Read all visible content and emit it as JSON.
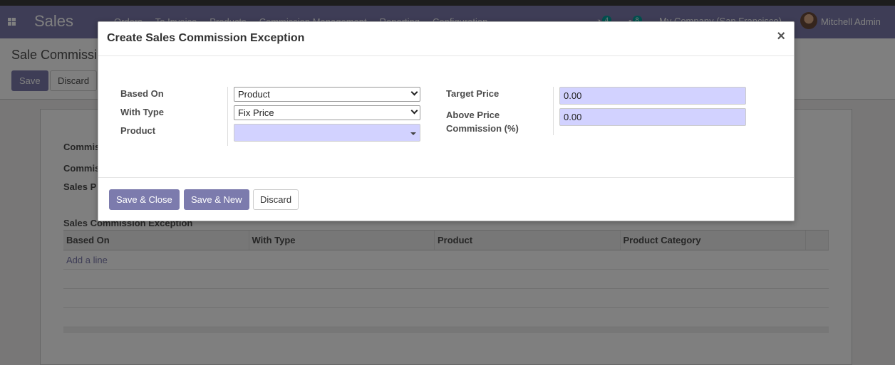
{
  "navbar": {
    "app_name": "Sales",
    "menu": [
      "Orders",
      "To Invoice",
      "Products",
      "Commission Management",
      "Reporting",
      "Configuration"
    ],
    "activity_count": "4",
    "messages_count": "8",
    "company": "My Company (San Francisco)",
    "user": "Mitchell Admin",
    "accent_color": "#7c7bad"
  },
  "control_panel": {
    "breadcrumb": "Sale Commissi",
    "save_label": "Save",
    "discard_label": "Discard"
  },
  "form_background": {
    "labels": [
      "Commis",
      "Commis",
      "Sales P"
    ],
    "section_title": "Sales Commission Exception",
    "columns": [
      "Based On",
      "With Type",
      "Product",
      "Product Category"
    ],
    "add_line": "Add a line"
  },
  "dialog": {
    "title": "Create Sales Commission Exception",
    "close_glyph": "×",
    "fields": {
      "based_on": {
        "label": "Based On",
        "value": "Product"
      },
      "with_type": {
        "label": "With Type",
        "value": "Fix Price"
      },
      "product": {
        "label": "Product",
        "value": ""
      },
      "target_price": {
        "label": "Target Price",
        "value": "0.00"
      },
      "above_price_commission": {
        "label": "Above Price Commission (%)",
        "value": "0.00"
      }
    },
    "buttons": {
      "save_close": "Save & Close",
      "save_new": "Save & New",
      "discard": "Discard"
    }
  }
}
